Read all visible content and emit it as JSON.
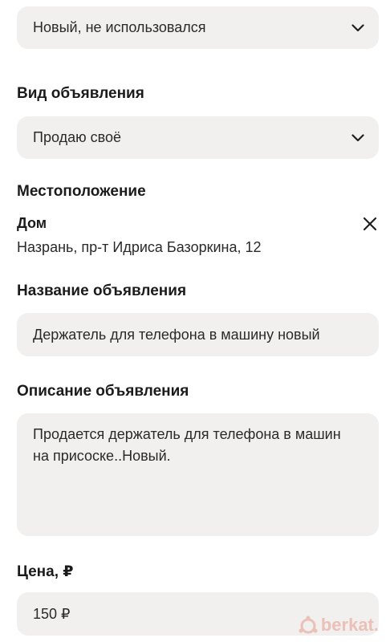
{
  "condition": {
    "value": "Новый, не использовался"
  },
  "ad_type": {
    "label": "Вид объявления",
    "value": "Продаю своё"
  },
  "location": {
    "label": "Местоположение",
    "place_name": "Дом",
    "address": "Назрань, пр-т Идриса Базоркина, 12"
  },
  "title": {
    "label": "Название объявления",
    "value": "Держатель для телефона в машину новый"
  },
  "description": {
    "label": "Описание объявления",
    "value": "Продается держатель для телефона в машин\nна присоске..Новый."
  },
  "price": {
    "label": "Цена, ₽",
    "value": "150 ₽"
  },
  "watermark": {
    "text": "berkat.",
    "color": "#e9b8ae"
  }
}
